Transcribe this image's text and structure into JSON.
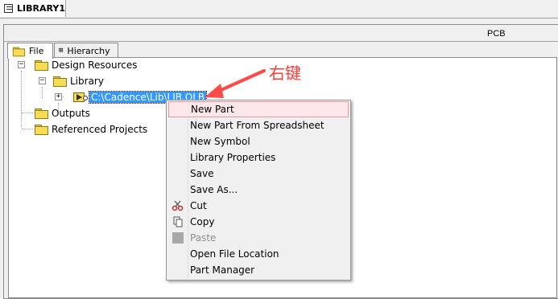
{
  "window": {
    "tab_title": "LIBRARY1",
    "right_label": "PCB"
  },
  "panel_tabs": [
    {
      "label": "File",
      "active": true
    },
    {
      "label": "Hierarchy",
      "active": false
    }
  ],
  "tree": {
    "design_resources": "Design Resources",
    "library": "Library",
    "selected_file": "C:\\Cadence\\Lib\\LIB.OLB",
    "outputs": "Outputs",
    "referenced_projects": "Referenced Projects"
  },
  "annotation": {
    "text": "右键",
    "color": "#ff3b3b"
  },
  "context_menu": {
    "items": [
      {
        "label": "New Part",
        "highlighted": true
      },
      {
        "label": "New Part From Spreadsheet"
      },
      {
        "label": "New Symbol"
      },
      {
        "label": "Library Properties"
      },
      {
        "label": "Save"
      },
      {
        "label": "Save As..."
      },
      {
        "label": "Cut",
        "icon": "scissors-icon"
      },
      {
        "label": "Copy",
        "icon": "copy-icon"
      },
      {
        "label": "Paste",
        "icon": "paste-icon",
        "disabled": true
      },
      {
        "label": "Open File Location"
      },
      {
        "label": "Part Manager"
      }
    ]
  },
  "colors": {
    "selection": "#3399ff",
    "menu_highlight": "#fde7ea",
    "folder": "#f7dd55"
  }
}
